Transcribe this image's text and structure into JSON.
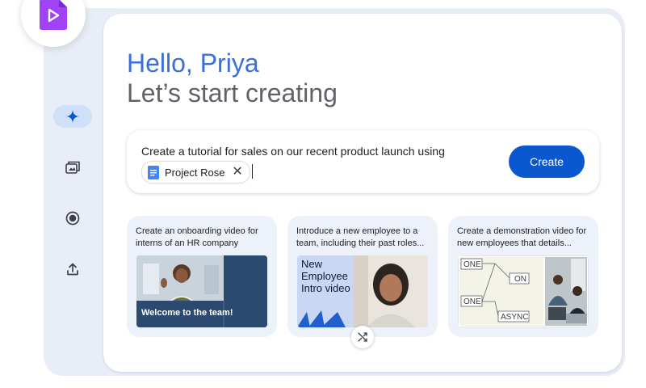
{
  "greeting": {
    "hello": "Hello, Priya",
    "subtitle": "Let’s start creating"
  },
  "prompt": {
    "text": "Create a tutorial for sales on our recent product launch using",
    "chip_label": "Project Rose",
    "chip_remove": "✕",
    "create_label": "Create"
  },
  "nav": [
    {
      "icon": "sparkle-icon",
      "active": true
    },
    {
      "icon": "media-library-icon",
      "active": false
    },
    {
      "icon": "record-icon",
      "active": false
    },
    {
      "icon": "upload-icon",
      "active": false
    }
  ],
  "cards": [
    {
      "text": "Create an onboarding video for interns of an HR company",
      "thumb_caption": "Welcome to the team!"
    },
    {
      "text": "Introduce a new employee to a team, including their past roles...",
      "thumb_title": "New Employee Intro video"
    },
    {
      "text": "Create a demonstration video for new employees that details...",
      "diagram_labels": [
        "ONE",
        "ON",
        "ONE",
        "ASYNC"
      ]
    }
  ],
  "colors": {
    "accent": "#0b57d0",
    "app_icon": "#a142f4",
    "hello_text": "#3a6fd8",
    "subtitle_text": "#5f6368",
    "card_bg": "#edf1f9"
  }
}
